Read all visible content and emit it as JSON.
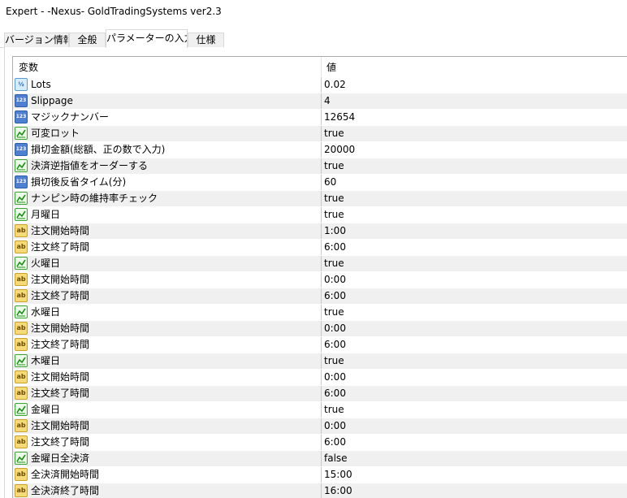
{
  "window": {
    "title": "Expert - -Nexus- GoldTradingSystems ver2.3"
  },
  "tabs": [
    {
      "label": "バージョン情報"
    },
    {
      "label": "全般"
    },
    {
      "label": "パラメーターの入力"
    },
    {
      "label": "仕様"
    }
  ],
  "grid": {
    "header_variable": "変数",
    "header_value": "値",
    "rows": [
      {
        "icon": "double-icon",
        "name": "Lots",
        "value": "0.02"
      },
      {
        "icon": "int-icon",
        "name": "Slippage",
        "value": "4"
      },
      {
        "icon": "int-icon",
        "name": "マジックナンバー",
        "value": "12654"
      },
      {
        "icon": "bool-icon",
        "name": "可変ロット",
        "value": "true"
      },
      {
        "icon": "int-icon",
        "name": "損切金額(総額、正の数で入力)",
        "value": "20000"
      },
      {
        "icon": "bool-icon",
        "name": "決済逆指値をオーダーする",
        "value": "true"
      },
      {
        "icon": "int-icon",
        "name": "損切後反省タイム(分)",
        "value": "60"
      },
      {
        "icon": "bool-icon",
        "name": "ナンピン時の維持率チェック",
        "value": "true"
      },
      {
        "icon": "bool-icon",
        "name": "月曜日",
        "value": "true"
      },
      {
        "icon": "string-icon",
        "name": "注文開始時間",
        "value": "1:00"
      },
      {
        "icon": "string-icon",
        "name": "注文終了時間",
        "value": "6:00"
      },
      {
        "icon": "bool-icon",
        "name": "火曜日",
        "value": "true"
      },
      {
        "icon": "string-icon",
        "name": "注文開始時間",
        "value": "0:00"
      },
      {
        "icon": "string-icon",
        "name": "注文終了時間",
        "value": "6:00"
      },
      {
        "icon": "bool-icon",
        "name": "水曜日",
        "value": "true"
      },
      {
        "icon": "string-icon",
        "name": "注文開始時間",
        "value": "0:00"
      },
      {
        "icon": "string-icon",
        "name": "注文終了時間",
        "value": "6:00"
      },
      {
        "icon": "bool-icon",
        "name": "木曜日",
        "value": "true"
      },
      {
        "icon": "string-icon",
        "name": "注文開始時間",
        "value": "0:00"
      },
      {
        "icon": "string-icon",
        "name": "注文終了時間",
        "value": "6:00"
      },
      {
        "icon": "bool-icon",
        "name": "金曜日",
        "value": "true"
      },
      {
        "icon": "string-icon",
        "name": "注文開始時間",
        "value": "0:00"
      },
      {
        "icon": "string-icon",
        "name": "注文終了時間",
        "value": "6:00"
      },
      {
        "icon": "bool-icon",
        "name": "金曜日全決済",
        "value": "false"
      },
      {
        "icon": "string-icon",
        "name": "全決済開始時間",
        "value": "15:00"
      },
      {
        "icon": "string-icon",
        "name": "全決済終了時間",
        "value": "16:00"
      }
    ]
  },
  "icons": {
    "double-icon": "½",
    "int-icon": "123",
    "string-icon": "ab",
    "bool-icon": "checkmark-chart"
  },
  "colors": {
    "alt_row": "#f0f0f0",
    "tab_inactive": "#f0f0f0",
    "border": "#adadad"
  }
}
